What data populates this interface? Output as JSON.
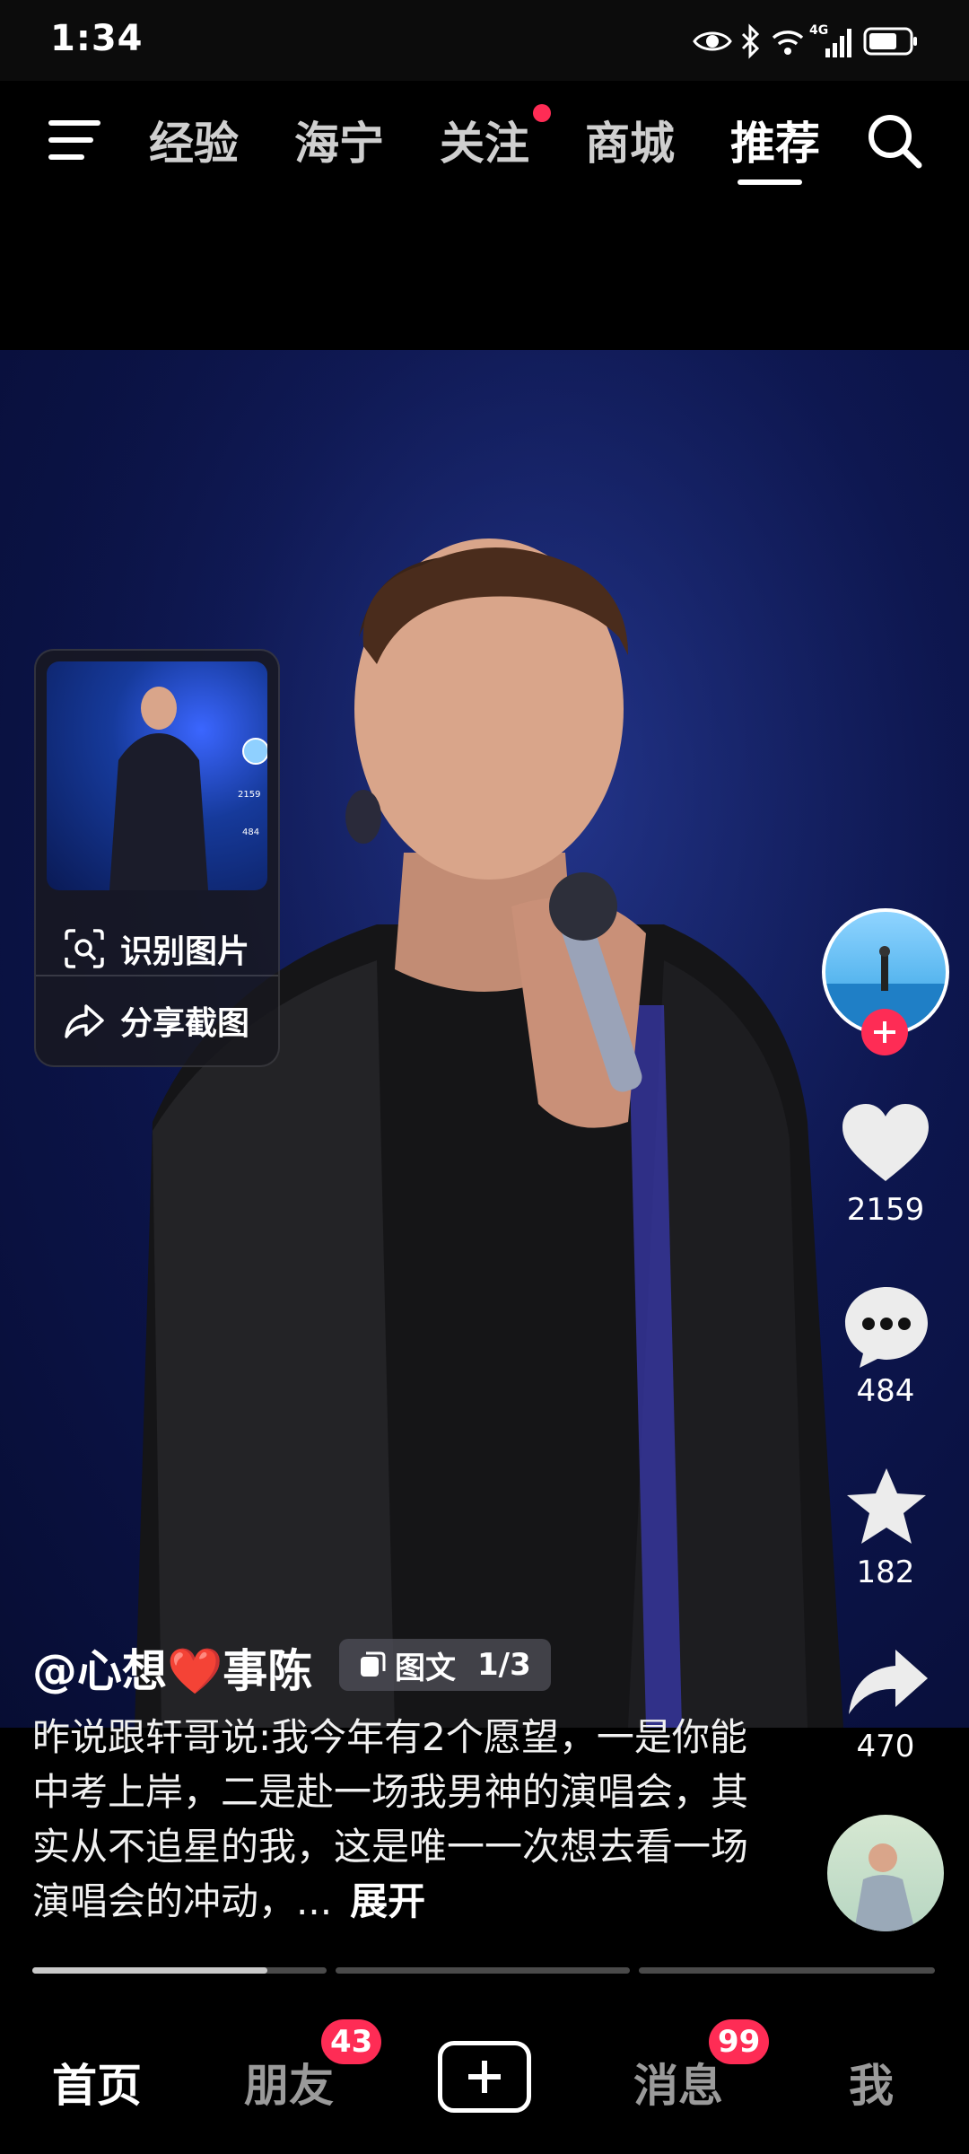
{
  "status_bar": {
    "time": "1:34",
    "network": "4G",
    "icons": [
      "eye-icon",
      "bluetooth-icon",
      "wifi-icon",
      "signal-icon",
      "battery-icon"
    ]
  },
  "top_nav": {
    "menu_icon": "menu-icon",
    "tabs": [
      {
        "label": "经验",
        "active": false
      },
      {
        "label": "海宁",
        "active": false
      },
      {
        "label": "关注",
        "active": false,
        "has_dot": true
      },
      {
        "label": "商城",
        "active": false
      },
      {
        "label": "推荐",
        "active": true
      }
    ],
    "search_icon": "search-icon"
  },
  "popup": {
    "thumb_counts": [
      "2159",
      "484"
    ],
    "identify_label": "识别图片",
    "share_label": "分享截图"
  },
  "rail": {
    "likes": "2159",
    "comments": "484",
    "favorites": "182",
    "shares": "470"
  },
  "caption": {
    "author": "@心想❤️事陈",
    "badge_label": "图文",
    "badge_page": "1/3",
    "description": "昨说跟轩哥说:我今年有2个愿望，一是你能中考上岸，二是赴一场我男神的演唱会，其实从不追星的我，这是唯一一次想去看一场演唱会的冲动，...",
    "expand_label": "展开"
  },
  "progress": {
    "segments": 3,
    "current_segment_fill": 0.8
  },
  "bottom_nav": {
    "items": [
      {
        "label": "首页",
        "active": true
      },
      {
        "label": "朋友",
        "badge": "43"
      },
      {
        "label": "plus-icon"
      },
      {
        "label": "消息",
        "badge": "99"
      },
      {
        "label": "我"
      }
    ]
  },
  "colors": {
    "accent_red": "#fe2c55",
    "background": "#000000"
  }
}
